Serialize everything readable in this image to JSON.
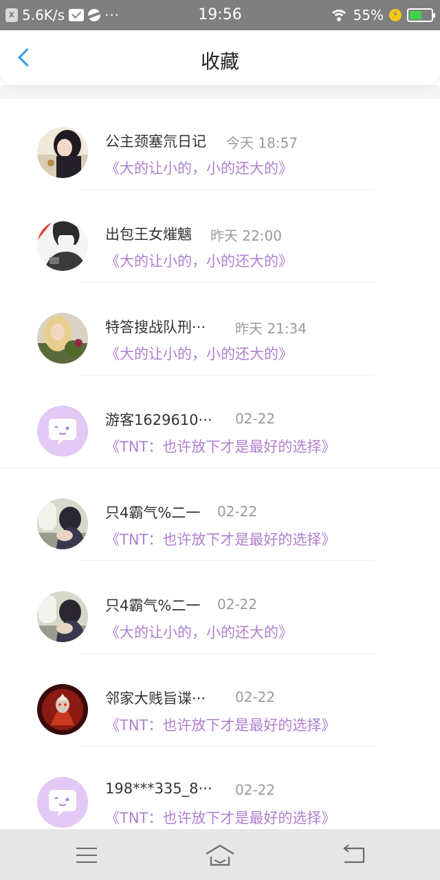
{
  "status_bar": {
    "net_speed": "5.6K/s",
    "dots": "···",
    "time": "19:56",
    "battery": "55%",
    "battery_level": 0.55
  },
  "header": {
    "title": "收藏"
  },
  "items": [
    {
      "name": "公主颈塞氘日记",
      "time": "今天 18:57",
      "desc": "《大的让小的，小的还大的》",
      "avatar": "girl-headphones"
    },
    {
      "name": "出包王女熣魑",
      "time": "昨天 22:00",
      "desc": "《大的让小的，小的还大的》",
      "avatar": "anime-boy"
    },
    {
      "name": "特答搜战队刑···",
      "time": "昨天 21:34",
      "desc": "《大的让小的，小的还大的》",
      "avatar": "blonde-girl"
    },
    {
      "name": "游客1629610···",
      "time": "02-22",
      "desc": "《TNT：也许放下才是最好的选择》",
      "avatar": "default-purple"
    },
    {
      "name": "只4霸气%二一",
      "time": "02-22",
      "desc": "《TNT：也许放下才是最好的选择》",
      "avatar": "window-girl"
    },
    {
      "name": "只4霸气%二一",
      "time": "02-22",
      "desc": "《大的让小的，小的还大的》",
      "avatar": "window-girl"
    },
    {
      "name": "邻家大贱旨谍···",
      "time": "02-22",
      "desc": "《TNT：也许放下才是最好的选择》",
      "avatar": "red-warrior"
    },
    {
      "name": "198***335_8···",
      "time": "02-22",
      "desc": "《TNT：也许放下才是最好的选择》",
      "avatar": "default-purple"
    }
  ],
  "colors": {
    "accent_back": "#2e9bf0",
    "desc_purple": "#b07fcf",
    "avatar_default": "#e3c9f5"
  }
}
